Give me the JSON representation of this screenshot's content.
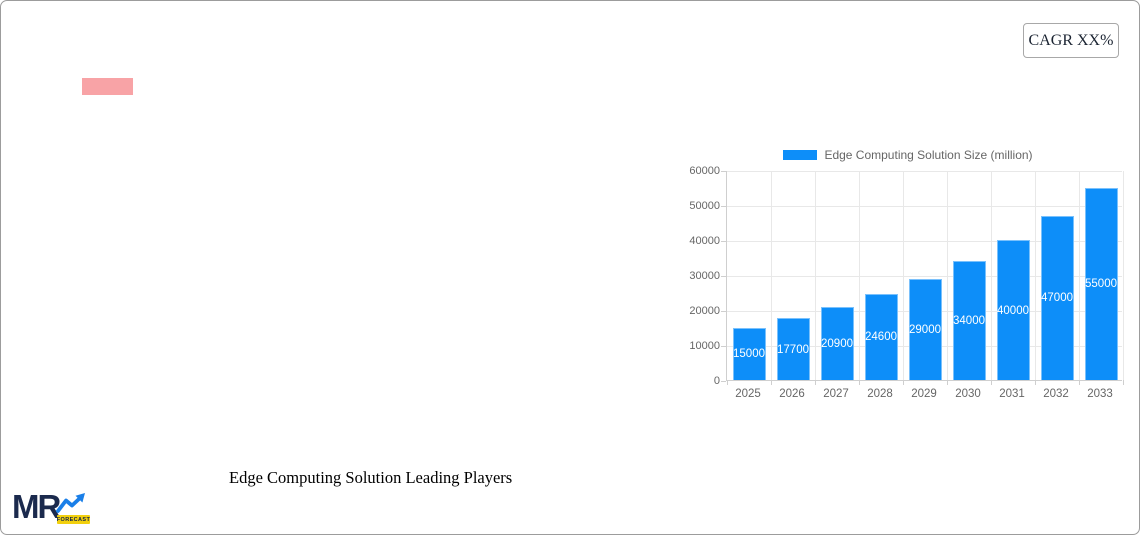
{
  "cagr_badge": {
    "label": "CAGR XX%"
  },
  "footer": {
    "title": "Edge Computing Solution Leading Players"
  },
  "logo": {
    "text": "MR",
    "badge": "FORECAST"
  },
  "colors": {
    "bar": "#0d8ef9",
    "pink_bar": "#f8a3a6",
    "grid": "#e8e8e8",
    "axis": "#cfcfcf",
    "tick_text": "#666666",
    "value_text": "#ffffff",
    "logo_navy": "#1b2a4d",
    "logo_arrow_blue": "#1a7fe8",
    "logo_yellow": "#f2d00e"
  },
  "chart_data": {
    "type": "bar",
    "legend": "Edge Computing Solution Size (million)",
    "legend_position": "top",
    "categories": [
      "2025",
      "2026",
      "2027",
      "2028",
      "2029",
      "2030",
      "2031",
      "2032",
      "2033"
    ],
    "values": [
      15000,
      17700,
      20900,
      24600,
      29000,
      34000,
      40000,
      47000,
      55000
    ],
    "xlabel": "",
    "ylabel": "",
    "ylim": [
      0,
      60000
    ],
    "yticks": [
      0,
      10000,
      20000,
      30000,
      40000,
      50000,
      60000
    ],
    "grid": true,
    "value_labels": "inside-center"
  }
}
